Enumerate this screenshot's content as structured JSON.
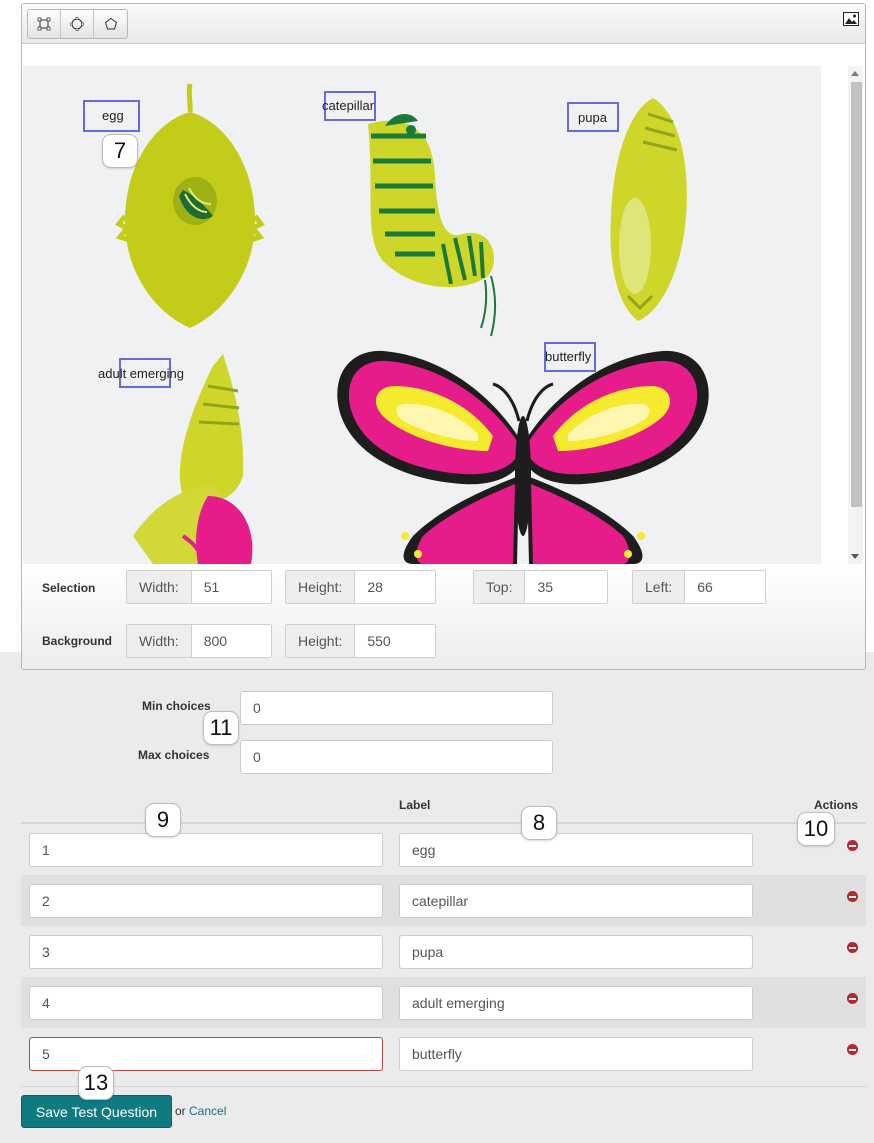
{
  "toolbar": {
    "tools": [
      "rectangle-tool",
      "circle-tool",
      "polygon-tool"
    ],
    "background_image_icon": "image-icon"
  },
  "hotspots": [
    {
      "label": "egg"
    },
    {
      "label": "catepillar"
    },
    {
      "label": "pupa"
    },
    {
      "label": "adult emerging"
    },
    {
      "label": "butterfly"
    }
  ],
  "selection": {
    "title": "Selection",
    "width_label": "Width:",
    "width": "51",
    "height_label": "Height:",
    "height": "28",
    "top_label": "Top:",
    "top": "35",
    "left_label": "Left:",
    "left": "66"
  },
  "background": {
    "title": "Background",
    "width_label": "Width:",
    "width": "800",
    "height_label": "Height:",
    "height": "550"
  },
  "choices": {
    "min_label": "Min choices",
    "min_value": "0",
    "max_label": "Max choices",
    "max_value": "0"
  },
  "table": {
    "label_header": "Label",
    "actions_header": "Actions",
    "rows": [
      {
        "value": "1",
        "label": "egg"
      },
      {
        "value": "2",
        "label": "catepillar"
      },
      {
        "value": "3",
        "label": "pupa"
      },
      {
        "value": "4",
        "label": "adult emerging"
      },
      {
        "value": "5",
        "label": "butterfly"
      }
    ]
  },
  "markers": {
    "m7": "7",
    "m8": "8",
    "m9": "9",
    "m10": "10",
    "m11": "11",
    "m13": "13"
  },
  "footer": {
    "save_label": "Save Test Question",
    "or_text": "or",
    "cancel_label": "Cancel"
  },
  "colors": {
    "accent": "#0f7a80",
    "hotspot_border": "#6a6ae0",
    "remove": "#b3292e",
    "error_border": "#b94a48",
    "cancel_link": "#1a6e86"
  }
}
